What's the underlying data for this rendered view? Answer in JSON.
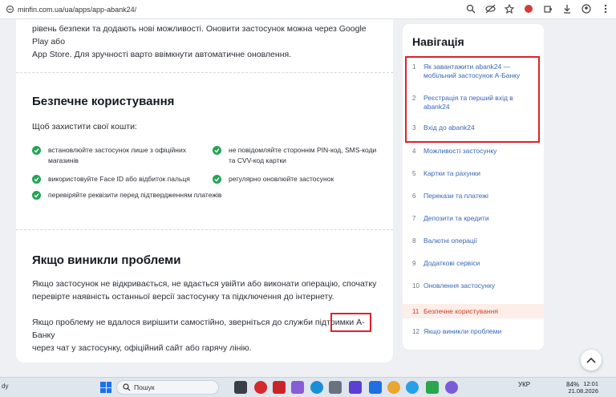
{
  "browser": {
    "url": "minfin.com.ua/ua/apps/app-abank24/"
  },
  "content": {
    "intro_line1": "рівень безпеки та додають нові можливості. Оновити застосунок можна через Google Play або",
    "intro_line2": "App Store. Для зручності варто ввімкнути автоматичне оновлення.",
    "safe_heading": "Безпечне користування",
    "safe_lead": "Щоб захистити свої кошти:",
    "checks": [
      "встановлюйте застосунок лише з офіційних магазинів",
      "не повідомляйте стороннім PIN-код, SMS-коди та CVV-код картки",
      "використовуйте Face ID або відбиток пальця",
      "регулярно оновлюйте застосунок",
      "перевіряйте реквізити перед підтвердженням платежів"
    ],
    "problems_heading": "Якщо виникли проблеми",
    "problems_p1_line1": "Якщо застосунок не відкривається, не вдається увійти або виконати операцію, спочатку",
    "problems_p1_line2": "перевірте наявність останньої версії застосунку та підключення до інтернету.",
    "problems_p2_line1_a": "Якщо проблему не вдалося вирішити самостійно, зверніться до служби підтримки",
    "problems_p2_highlight": "А-Банку",
    "problems_p2_line2": "через чат у застосунку, офіційний сайт або гарячу лінію."
  },
  "nav": {
    "title": "Навігація",
    "items": [
      {
        "num": "1",
        "label": "Як завантажити abank24 — мобільний застосунок А-Банку"
      },
      {
        "num": "2",
        "label": "Реєстрація та перший вхід в abank24"
      },
      {
        "num": "3",
        "label": "Вхід до abank24"
      },
      {
        "num": "4",
        "label": "Можливості застосунку"
      },
      {
        "num": "5",
        "label": "Картки та рахунки"
      },
      {
        "num": "6",
        "label": "Перекази та платежі"
      },
      {
        "num": "7",
        "label": "Депозити та кредити"
      },
      {
        "num": "8",
        "label": "Валютні операції"
      },
      {
        "num": "9",
        "label": "Додаткові сервіси"
      },
      {
        "num": "10",
        "label": "Оновлення застосунку"
      },
      {
        "num": "11",
        "label": "Безпечне користування"
      },
      {
        "num": "12",
        "label": "Якщо виникли проблеми"
      }
    ],
    "active_index": 10
  },
  "taskbar": {
    "left_text": "dy",
    "search_placeholder": "Пошук",
    "lang": "УКР",
    "battery": "84%",
    "time": "12:01",
    "date": "21.08.2026"
  },
  "colors": {
    "accent_red": "#e0212a",
    "check_green": "#23a455",
    "link_blue": "#3b66b3",
    "active_bg": "#fdeee9"
  }
}
